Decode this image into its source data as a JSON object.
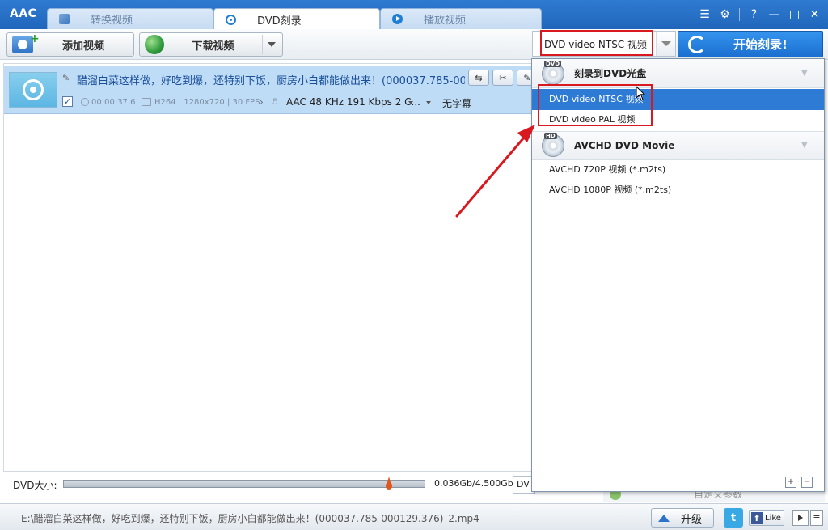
{
  "app": {
    "logo": "AAC",
    "tabs": [
      {
        "label": "转换视频",
        "icon": "convert-icon"
      },
      {
        "label": "DVD刻录",
        "icon": "disc-icon"
      },
      {
        "label": "播放视频",
        "icon": "play-icon"
      }
    ],
    "active_tab": "DVD刻录"
  },
  "toolbar": {
    "add_video_label": "添加视频",
    "download_video_label": "下载视频",
    "format_value": "DVD video NTSC 视频",
    "start_burn_label": "开始刻录!"
  },
  "file": {
    "title": "醋溜白菜这样做，好吃到爆，还特别下饭，厨房小白都能做出来！(000037.785-000...",
    "duration": "00:00:37.6",
    "video_info": "H264 | 1280x720 | 30 FPS",
    "audio_info": "AAC 48 KHz 191 Kbps 2 C...",
    "subtitle": "无字幕",
    "checked": true
  },
  "dvd_size": {
    "label": "DVD大小:",
    "value": "0.036Gb/4.500Gb",
    "progress": 0.0
  },
  "small_combo_value": "DV",
  "side_label": "自定义参数",
  "dropdown": {
    "groups": [
      {
        "title": "刻录到DVD光盘",
        "icon": "dvd-disc-icon",
        "items": [
          {
            "label": "DVD video NTSC 视频",
            "selected": true
          },
          {
            "label": "DVD video PAL 视频",
            "selected": false
          }
        ]
      },
      {
        "title": "AVCHD DVD Movie",
        "icon": "hd-disc-icon",
        "items": [
          {
            "label": "AVCHD 720P 视频 (*.m2ts)",
            "selected": false
          },
          {
            "label": "AVCHD 1080P 视频 (*.m2ts)",
            "selected": false
          }
        ]
      }
    ]
  },
  "status": {
    "path": "E:\\醋溜白菜这样做，好吃到爆，还特别下饭，厨房小白都能做出来！(000037.785-000129.376)_2.mp4",
    "upgrade_label": "升级",
    "twitter_label": "t",
    "facebook_label": "Like"
  },
  "colors": {
    "titlebar": "#2f7bd1",
    "selected_row": "#bfdcf7",
    "accent": "#2e7bd6",
    "annotation": "#d8191f"
  }
}
